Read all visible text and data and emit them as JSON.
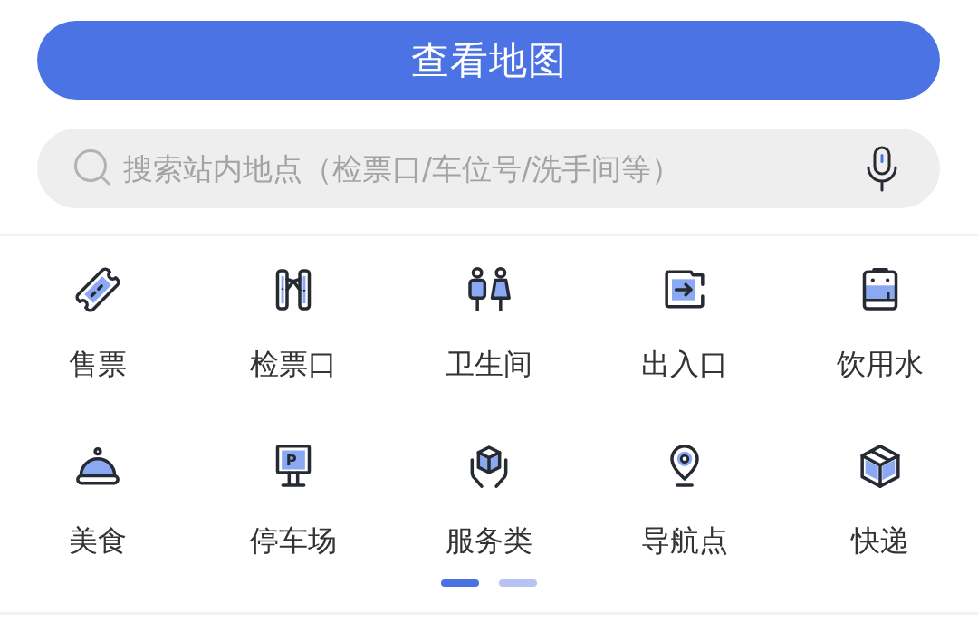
{
  "map_button": {
    "label": "查看地图"
  },
  "search": {
    "placeholder": "搜索站内地点（检票口/车位号/洗手间等）"
  },
  "categories": [
    {
      "label": "售票"
    },
    {
      "label": "检票口"
    },
    {
      "label": "卫生间"
    },
    {
      "label": "出入口"
    },
    {
      "label": "饮用水"
    },
    {
      "label": "美食"
    },
    {
      "label": "停车场",
      "sign_text": "P"
    },
    {
      "label": "服务类"
    },
    {
      "label": "导航点"
    },
    {
      "label": "快递"
    }
  ],
  "pager": [
    {
      "selected": true
    },
    {
      "selected": false
    }
  ]
}
